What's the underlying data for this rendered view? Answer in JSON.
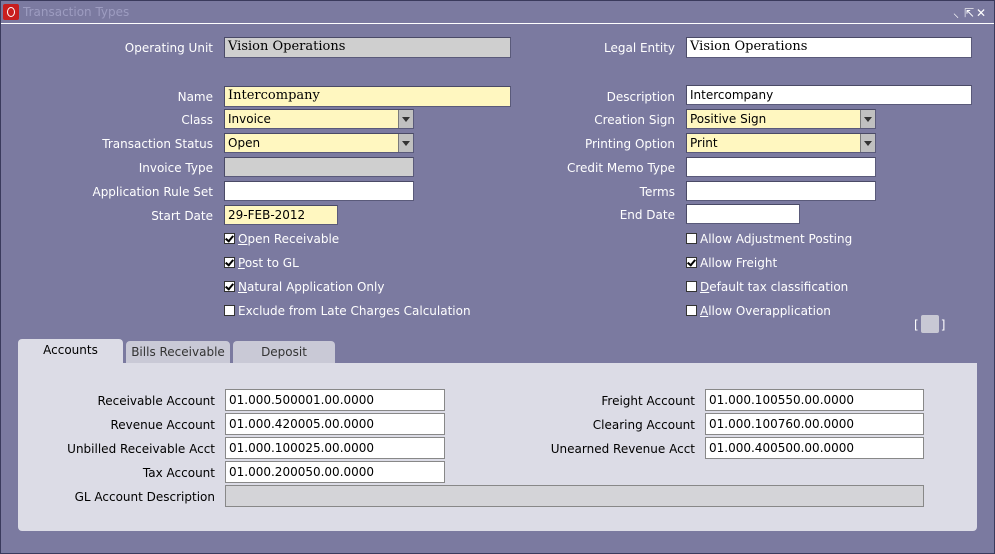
{
  "window": {
    "title": "Transaction Types",
    "controls": [
      "⸜",
      "⇱",
      "✕"
    ]
  },
  "header": {
    "operating_unit": {
      "label": "Operating Unit",
      "value": "Vision Operations"
    },
    "legal_entity": {
      "label": "Legal Entity",
      "value": "Vision Operations"
    }
  },
  "form": {
    "name": {
      "label": "Name",
      "value": "Intercompany"
    },
    "class": {
      "label": "Class",
      "value": "Invoice"
    },
    "transaction_status": {
      "label": "Transaction Status",
      "value": "Open"
    },
    "invoice_type": {
      "label": "Invoice Type",
      "value": ""
    },
    "application_rule_set": {
      "label": "Application Rule Set",
      "value": ""
    },
    "start_date": {
      "label": "Start Date",
      "value": "29-FEB-2012"
    },
    "description": {
      "label": "Description",
      "value": "Intercompany"
    },
    "creation_sign": {
      "label": "Creation Sign",
      "value": "Positive Sign"
    },
    "printing_option": {
      "label": "Printing Option",
      "value": "Print"
    },
    "credit_memo_type": {
      "label": "Credit Memo Type",
      "value": ""
    },
    "terms": {
      "label": "Terms",
      "value": ""
    },
    "end_date": {
      "label": "End Date",
      "value": ""
    }
  },
  "checkboxes": {
    "open_receivable": {
      "accel": "O",
      "rest": "pen Receivable",
      "checked": true
    },
    "post_to_gl": {
      "accel": "P",
      "rest": "ost to GL",
      "checked": true
    },
    "natural_application_only": {
      "accel": "N",
      "rest": "atural Application Only",
      "checked": true
    },
    "exclude_late_charges": {
      "accel": "",
      "rest": "Exclude from Late Charges Calculation",
      "checked": false
    },
    "allow_adjustment_posting": {
      "accel": "",
      "rest": "Allow Adjustment Posting",
      "checked": false
    },
    "allow_freight": {
      "accel": "",
      "rest": "Allow Freight",
      "checked": true
    },
    "default_tax_classification": {
      "accel": "D",
      "rest": "efault tax classification",
      "checked": false
    },
    "allow_overapplication": {
      "accel": "A",
      "rest": "llow Overapplication",
      "checked": false
    }
  },
  "bracket_button": {
    "left": "[",
    "right": "]"
  },
  "tabs": [
    {
      "label": "Accounts",
      "active": true
    },
    {
      "label": "Bills Receivable",
      "active": false
    },
    {
      "label": "Deposit",
      "active": false
    }
  ],
  "accounts": {
    "receivable_account": {
      "label": "Receivable Account",
      "value": "01.000.500001.00.0000"
    },
    "revenue_account": {
      "label": "Revenue Account",
      "value": "01.000.420005.00.0000"
    },
    "unbilled_receivable_acct": {
      "label": "Unbilled Receivable Acct",
      "value": "01.000.100025.00.0000"
    },
    "tax_account": {
      "label": "Tax Account",
      "value": "01.000.200050.00.0000"
    },
    "gl_account_description": {
      "label": "GL Account Description",
      "value": ""
    },
    "freight_account": {
      "label": "Freight Account",
      "value": "01.000.100550.00.0000"
    },
    "clearing_account": {
      "label": "Clearing Account",
      "value": "01.000.100760.00.0000"
    },
    "unearned_revenue_acct": {
      "label": "Unearned Revenue Acct",
      "value": "01.000.400500.00.0000"
    }
  }
}
